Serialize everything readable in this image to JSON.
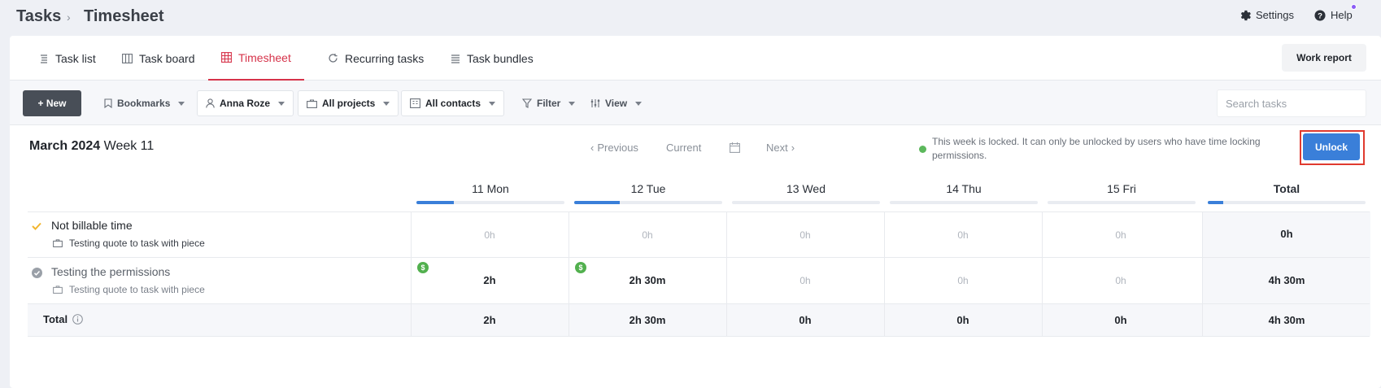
{
  "header": {
    "breadcrumb_root": "Tasks",
    "breadcrumb_separator": "›",
    "breadcrumb_page": "Timesheet",
    "settings_label": "Settings",
    "help_label": "Help"
  },
  "tabs": [
    {
      "label": "Task list",
      "icon": "list-icon"
    },
    {
      "label": "Task board",
      "icon": "board-icon"
    },
    {
      "label": "Timesheet",
      "icon": "grid-icon",
      "active": true
    },
    {
      "label": "Recurring tasks",
      "icon": "refresh-icon"
    },
    {
      "label": "Task bundles",
      "icon": "stack-icon"
    }
  ],
  "work_report_label": "Work report",
  "toolbar": {
    "new_label": "+ New",
    "bookmarks_label": "Bookmarks",
    "user_label": "Anna Roze",
    "projects_label": "All projects",
    "contacts_label": "All contacts",
    "filter_label": "Filter",
    "view_label": "View",
    "search_placeholder": "Search tasks"
  },
  "week": {
    "month_year": "March 2024",
    "week_label": "Week 11",
    "previous_label": "Previous",
    "current_label": "Current",
    "next_label": "Next",
    "lock_message": "This week is locked. It can only be unlocked by users who have time locking permissions.",
    "unlock_label": "Unlock"
  },
  "days": [
    {
      "label": "11 Mon",
      "progress": 0.25
    },
    {
      "label": "12 Tue",
      "progress": 0.31
    },
    {
      "label": "13 Wed",
      "progress": 0
    },
    {
      "label": "14 Thu",
      "progress": 0
    },
    {
      "label": "15 Fri",
      "progress": 0
    }
  ],
  "total_header": {
    "label": "Total",
    "progress": 0.1
  },
  "rows": [
    {
      "name": "Not billable time",
      "project": "Testing quote to task with piece",
      "status": "checked",
      "cells": [
        "0h",
        "0h",
        "0h",
        "0h",
        "0h"
      ],
      "total": "0h"
    },
    {
      "name": "Testing the permissions",
      "project": "Testing quote to task with piece",
      "status": "done",
      "cells": [
        "2h",
        "2h 30m",
        "0h",
        "0h",
        "0h"
      ],
      "billable_marker": "$",
      "total": "4h 30m"
    }
  ],
  "totals": {
    "label": "Total",
    "cells": [
      "2h",
      "2h 30m",
      "0h",
      "0h",
      "0h"
    ],
    "total": "4h 30m"
  },
  "colors": {
    "accent_red": "#d6334a",
    "primary_blue": "#3a7fd9",
    "locked_green": "#5cb85c",
    "billable_green": "#52b04e"
  }
}
